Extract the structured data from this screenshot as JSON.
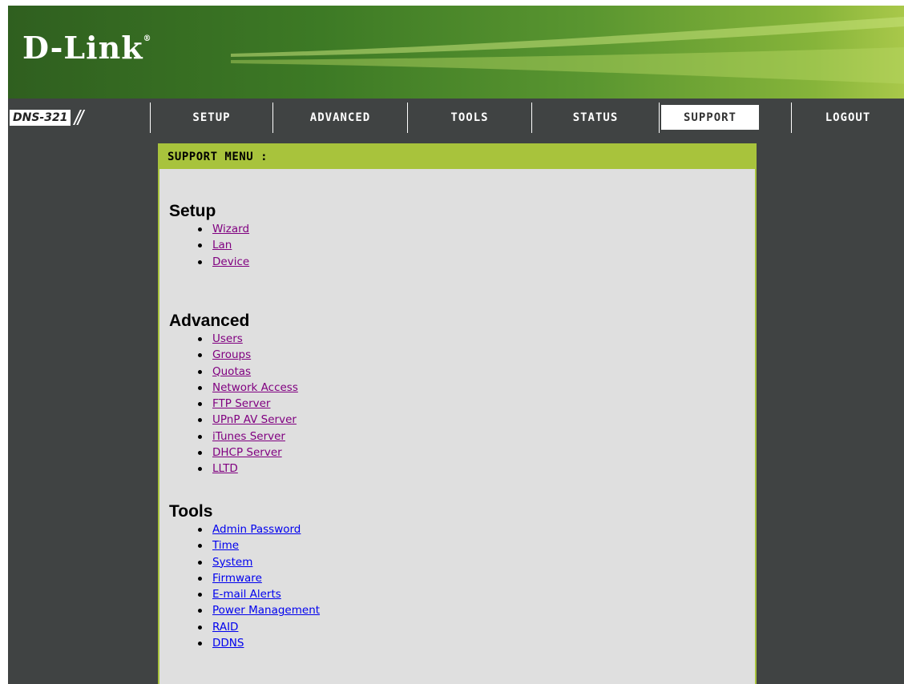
{
  "header": {
    "logo": "D-Link",
    "logo_mark": "®",
    "model": "DNS-321",
    "slashes": "//"
  },
  "nav": {
    "tabs": [
      {
        "label": "SETUP"
      },
      {
        "label": "ADVANCED"
      },
      {
        "label": "TOOLS"
      },
      {
        "label": "STATUS"
      },
      {
        "label": "SUPPORT",
        "active": true
      },
      {
        "label": "LOGOUT"
      }
    ]
  },
  "support": {
    "menu_title": "SUPPORT MENU :",
    "sections": [
      {
        "title": "Setup",
        "links": [
          "Wizard",
          "Lan",
          "Device"
        ]
      },
      {
        "title": "Advanced",
        "links": [
          "Users",
          "Groups",
          "Quotas",
          "Network Access",
          "FTP Server",
          "UPnP AV Server",
          "iTunes Server",
          "DHCP Server",
          "LLTD"
        ]
      },
      {
        "title": "Tools",
        "links": [
          "Admin Password",
          "Time",
          "System",
          "Firmware",
          "E-mail Alerts",
          "Power Management",
          "RAID",
          "DDNS"
        ]
      }
    ]
  },
  "colors": {
    "accent_green": "#a8c33c",
    "frame_gray": "#404343",
    "visited_link": "#800080",
    "link": "#0000ee"
  }
}
